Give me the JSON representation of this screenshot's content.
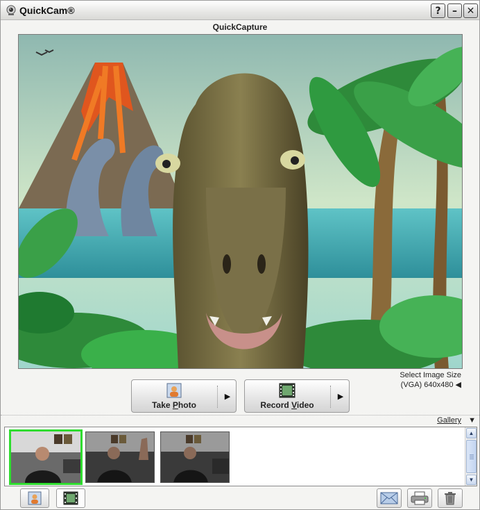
{
  "window": {
    "title": "QuickCam®",
    "help_glyph": "?",
    "minimize_glyph": "–",
    "close_glyph": "✕"
  },
  "header": {
    "subtitle": "QuickCapture"
  },
  "preview": {
    "scene": "dinosaur-avatar-jungle-volcano"
  },
  "image_size": {
    "label": "Select Image Size",
    "value": "(VGA) 640x480 ◀"
  },
  "actions": {
    "take_photo": {
      "pre": "Take ",
      "underline": "P",
      "post": "hoto",
      "arrow": "▶",
      "icon": "camera-photo-icon"
    },
    "record_video": {
      "pre": "Record ",
      "underline": "V",
      "post": "ideo",
      "arrow": "▶",
      "icon": "film-strip-icon"
    }
  },
  "gallery": {
    "label": "Gallery",
    "arrow": "▼",
    "thumbnails": [
      {
        "label": "webcam snapshot 1",
        "selected": true
      },
      {
        "label": "webcam snapshot 2",
        "selected": false
      },
      {
        "label": "webcam snapshot 3",
        "selected": false
      }
    ],
    "scroll_up": "▲",
    "scroll_down": "▼"
  },
  "toolbar": {
    "left": [
      "photo-mode-icon",
      "video-mode-icon"
    ],
    "right": [
      "email-icon",
      "printer-icon",
      "trash-icon"
    ]
  },
  "colors": {
    "selection": "#2fdc2f",
    "accent": "#2a3f66"
  }
}
